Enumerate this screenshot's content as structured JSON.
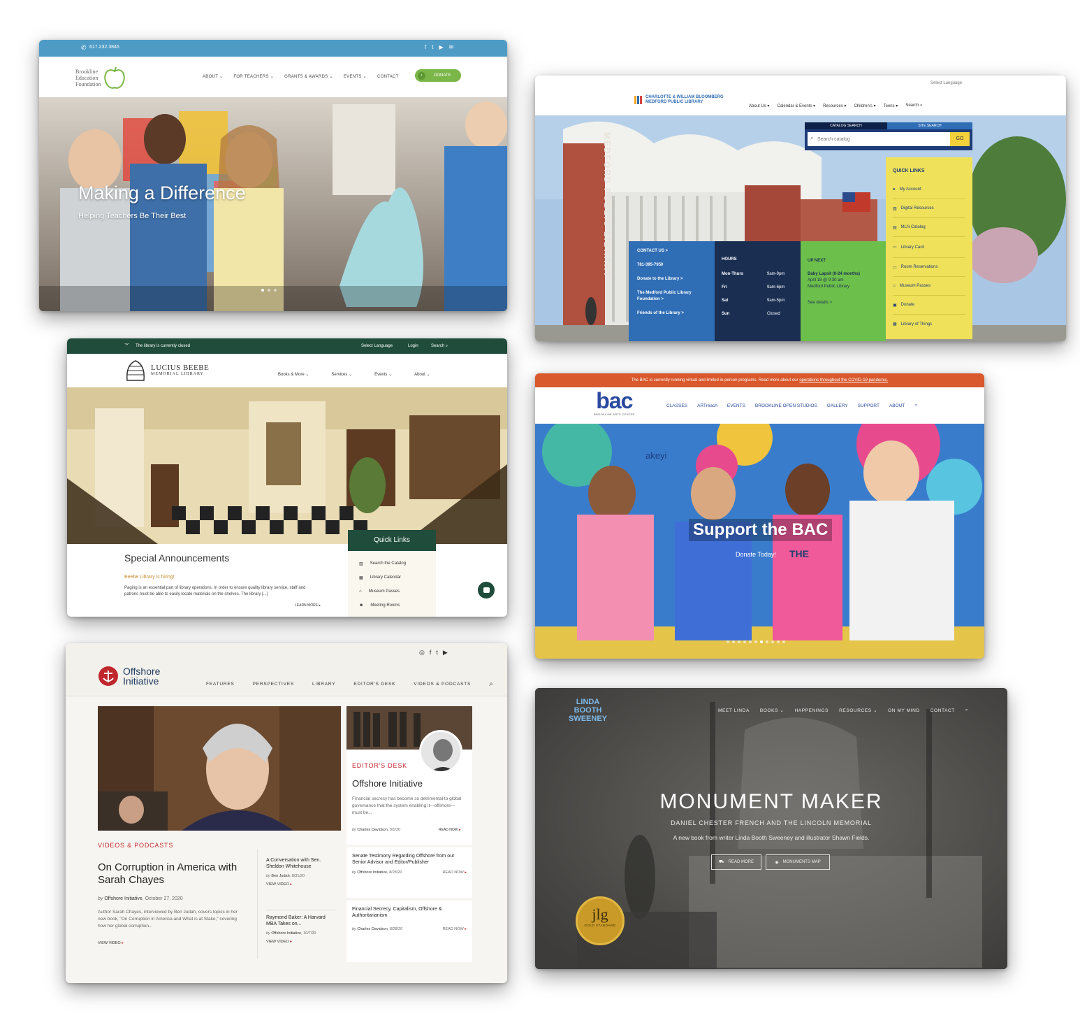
{
  "bef": {
    "phone": "617.232.3846",
    "logo_line1": "Brookline",
    "logo_line2": "Education",
    "logo_line3": "Foundation",
    "nav": [
      "ABOUT ⌄",
      "FOR TEACHERS ⌄",
      "GRANTS & AWARDS ⌄",
      "EVENTS ⌄",
      "CONTACT"
    ],
    "donate": "DONATE",
    "hero_title": "Making a Difference",
    "hero_subtitle": "Helping Teachers Be Their Best",
    "colors": {
      "topbar": "#4e9bc6",
      "donate": "#7ab648"
    }
  },
  "medford": {
    "select_language": "Select Language",
    "logo_line1": "CHARLOTTE & WILLIAM BLOOMBERG",
    "logo_line2": "MEDFORD PUBLIC LIBRARY",
    "nav": [
      "About Us ▾",
      "Calendar & Events ▾",
      "Resources ▾",
      "Children's ▾",
      "Teens ▾"
    ],
    "search": "Search",
    "building_text": "MEDFORD PUBLIC LIBRARY",
    "tab_catalog": "CATALOG SEARCH",
    "tab_site": "SITE SEARCH",
    "search_placeholder": "Search catalog",
    "go": "GO",
    "quick_links_title": "QUICK LINKS",
    "quick_links": [
      "My Account",
      "Digital Resources",
      "MLN Catalog",
      "Library Card",
      "Room Reservations",
      "Museum Passes",
      "Donate",
      "Library of Things"
    ],
    "contact_title": "CONTACT US >",
    "contact_phone": "781-395-7950",
    "contact_links": [
      "Donate to the Library >",
      "The Medford Public Library Foundation >",
      "Friends of the Library >"
    ],
    "hours_title": "HOURS",
    "hours": [
      [
        "Mon-Thurs",
        "9am-9pm"
      ],
      [
        "Fri",
        "9am-6pm"
      ],
      [
        "Sat",
        "9am-5pm"
      ],
      [
        "Sun",
        "Closed"
      ]
    ],
    "upnext_title": "UP NEXT",
    "upnext_event": "Baby Lapsit (0-24 months)",
    "upnext_date": "April 18 @ 9:30 am",
    "upnext_place": "Medford Public Library",
    "upnext_link": "See details >"
  },
  "beebe": {
    "closed": "The library is currently closed",
    "select_language": "Select Language",
    "login": "Login",
    "search": "Search",
    "logo_line1": "LUCIUS BEEBE",
    "logo_line2": "MEMORIAL LIBRARY",
    "nav": [
      "Books & More ⌄",
      "Services ⌄",
      "Events ⌄",
      "About ⌄"
    ],
    "announcements_title": "Special Announcements",
    "hiring": "Beebe Library is hiring!",
    "body": "Paging is an essential part of library operations. In order to ensure quality library service, staff and patrons must be able to easily locate materials on the shelves. The library [...]",
    "learn_more": "LEARN MORE",
    "quick_links_title": "Quick Links",
    "quick_links": [
      "Search the Catalog",
      "Library Calendar",
      "Museum Passes",
      "Meeting Rooms"
    ]
  },
  "bac": {
    "banner": "The BAC is currently running virtual and limited in-person programs. Read more about our ",
    "banner_link": "operations throughout the COVID-19 pandemic.",
    "logo": "bac",
    "logo_sub": "BROOKLINE ARTS CENTER",
    "nav": [
      "CLASSES",
      "ARTreach",
      "EVENTS",
      "BROOKLINE OPEN STUDIOS",
      "GALLERY",
      "SUPPORT",
      "ABOUT"
    ],
    "mural_text": "akeyi",
    "hero_title": "Support the BAC",
    "hero_subtitle": "Donate Today!",
    "shirt_text": "THE"
  },
  "offshore": {
    "logo_line1": "Offshore",
    "logo_line2": "Initiative",
    "nav": [
      "FEATURES",
      "PERSPECTIVES",
      "LIBRARY",
      "EDITOR'S DESK",
      "VIDEOS & PODCASTS"
    ],
    "feature_category": "VIDEOS & PODCASTS",
    "feature_title": "On Corruption in America with Sarah Chayes",
    "feature_by": "by",
    "feature_author": "Offshore Initiative",
    "feature_date": "October 27, 2020",
    "feature_excerpt": "Author Sarah Chayes, interviewed by Ben Judah, covers topics in her new book, \"On Corruption in America and What is at Stake,\" covering how her global corruption...",
    "view_video": "VIEW VIDEO",
    "side_items": [
      {
        "title": "A Conversation with Sen. Sheldon Whitehouse",
        "by": "by",
        "author": "Ben Judah",
        "date": "8/31/20",
        "link": "VIEW VIDEO"
      },
      {
        "title": "Raymond Baker: A Harvard MBA Takes on...",
        "by": "by",
        "author": "Offshore Initiative",
        "date": "10/7/20",
        "link": "VIEW VIDEO"
      }
    ],
    "editor_category": "EDITOR'S DESK",
    "editor_title": "Offshore Initiative",
    "editor_excerpt": "Financial secrecy has become so detrimental to global governance that the system enabling it—offshore—must be...",
    "editor_by": "by",
    "editor_author": "Charles Davidson",
    "editor_date": "9/1/20",
    "read_now": "READ NOW",
    "right_items": [
      {
        "title": "Senate Testimony Regarding Offshore from our Senior Advisor and Editor/Publisher",
        "by": "by",
        "author": "Offshore Initiative",
        "date": "8/28/20"
      },
      {
        "title": "Financial Secrecy, Capitalism, Offshore & Authoritarianism",
        "by": "by",
        "author": "Charles Davidson",
        "date": "8/28/20"
      }
    ]
  },
  "sweeney": {
    "logo_line1": "LINDA",
    "logo_line2": "BOOTH",
    "logo_line3": "SWEENEY",
    "nav": [
      "MEET LINDA",
      "BOOKS ⌄",
      "HAPPENINGS",
      "RESOURCES ⌄",
      "ON MY MIND",
      "CONTACT"
    ],
    "hero_title": "MONUMENT MAKER",
    "hero_subtitle": "DANIEL CHESTER FRENCH AND THE LINCOLN MEMORIAL",
    "hero_tagline": "A new book from writer Linda Booth Sweeney and illustrator Shawn Fields.",
    "btn_read": "READ MORE",
    "btn_map": "MONUMENTS MAP",
    "badge": "jlg",
    "badge_sub": "GOLD STANDARD"
  }
}
